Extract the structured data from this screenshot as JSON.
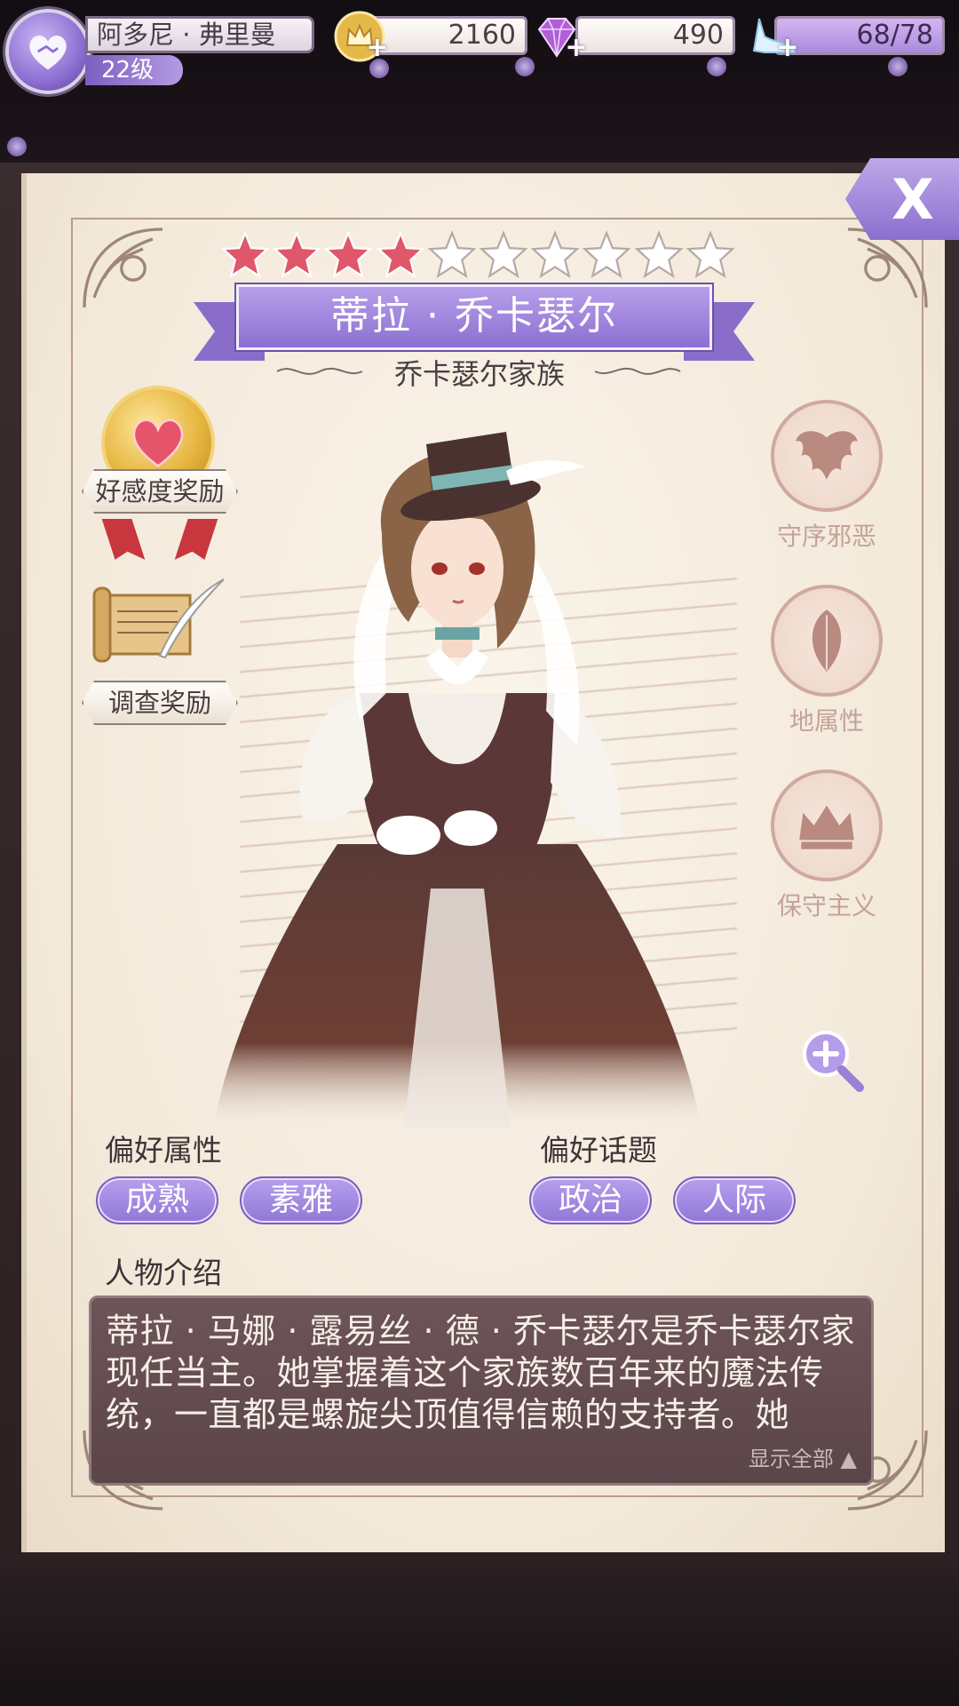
{
  "player": {
    "name": "阿多尼 · 弗里曼",
    "level": "22级"
  },
  "resources": {
    "gold": "2160",
    "gems": "490",
    "stamina": "68/78",
    "add_label": "+"
  },
  "close_label": "X",
  "character": {
    "rating": 4,
    "max_rating": 10,
    "name": "蒂拉 · 乔卡瑟尔",
    "family": "乔卡瑟尔家族"
  },
  "rewards": {
    "affection": "好感度奖励",
    "investigation": "调查奖励"
  },
  "traits": [
    {
      "icon": "bat-wings-icon",
      "label": "守序邪恶"
    },
    {
      "icon": "leaf-icon",
      "label": "地属性"
    },
    {
      "icon": "crown-icon",
      "label": "保守主义"
    }
  ],
  "preferences": {
    "attributes_title": "偏好属性",
    "attributes": [
      "成熟",
      "素雅"
    ],
    "topics_title": "偏好话题",
    "topics": [
      "政治",
      "人际"
    ]
  },
  "intro": {
    "title": "人物介绍",
    "text": "蒂拉 · 马娜 · 露易丝 · 德 · 乔卡瑟尔是乔卡瑟尔家现任当主。她掌握着这个家族数百年来的魔法传统，一直都是螺旋尖顶值得信赖的支持者。她",
    "show_all": "显示全部 ▲"
  },
  "colors": {
    "accent_purple": "#9077d8",
    "star_filled": "#e0566a",
    "star_empty": "#ffffff",
    "parchment": "#f6eee2",
    "intro_bg": "#5b4549"
  }
}
